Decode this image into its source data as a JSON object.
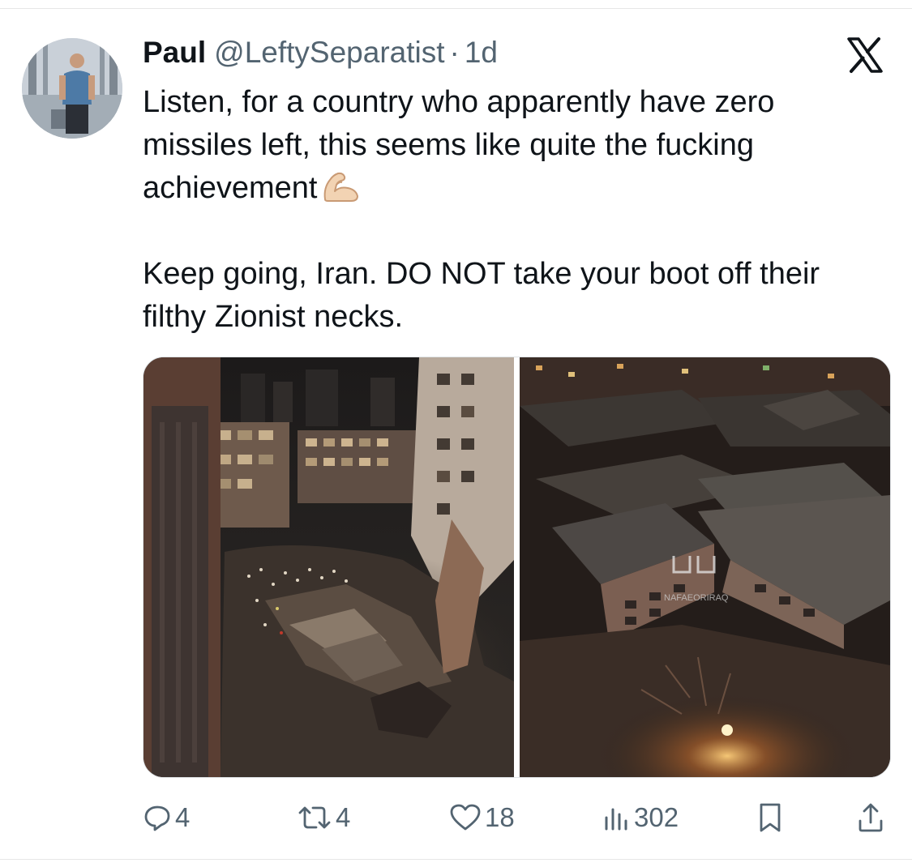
{
  "author": {
    "name": "Paul",
    "handle": "@LeftySeparatist",
    "separator": "·",
    "time": "1d"
  },
  "tweet": {
    "line_1": "Listen, for a country who apparently have zero missiles left, this seems like quite the fucking achievement",
    "emoji": "flexed-biceps-emoji",
    "line_2": "Keep going, Iran. DO NOT take your boot off their filthy Zionist necks."
  },
  "media": {
    "watermark_text": "NAFAEORIRAQ"
  },
  "actions": {
    "replies": "4",
    "retweets": "4",
    "likes": "18",
    "views": "302"
  },
  "icons": {
    "platform_logo": "x-logo-icon",
    "reply": "reply-icon",
    "retweet": "retweet-icon",
    "like": "heart-icon",
    "views": "views-icon",
    "bookmark": "bookmark-icon",
    "share": "share-icon"
  },
  "colors": {
    "text": "#0f1419",
    "secondary": "#536471",
    "border": "#e6e6e6"
  }
}
